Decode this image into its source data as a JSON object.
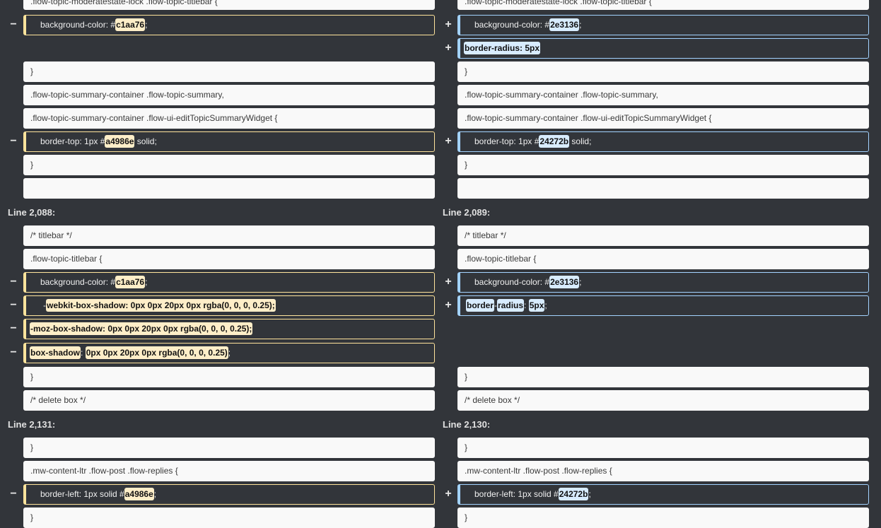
{
  "line_numbers": {
    "left_2": "Line 2,088:",
    "right_2": "Line 2,089:",
    "left_3": "Line 2,131:",
    "right_3": "Line 2,130:"
  },
  "markers": {
    "minus": "−",
    "plus": "+"
  },
  "block1": {
    "left_0": ".flow-topic-moderatestate-lock .flow-topic-titlebar {",
    "right_0": ".flow-topic-moderatestate-lock .flow-topic-titlebar {",
    "left_1": {
      "pre": "background-color: #",
      "hl": "c1aa76",
      "post": ";"
    },
    "right_1": {
      "pre": "background-color: #",
      "hl": "2e3136",
      "post": ";"
    },
    "right_2": {
      "hl": "border-radius: 5px"
    },
    "left_3": "}",
    "right_3": "}",
    "left_4": ".flow-topic-summary-container .flow-topic-summary,",
    "right_4": ".flow-topic-summary-container .flow-topic-summary,",
    "left_5": ".flow-topic-summary-container .flow-ui-editTopicSummaryWidget {",
    "right_5": ".flow-topic-summary-container .flow-ui-editTopicSummaryWidget {",
    "left_6": {
      "pre": "border-top: 1px #",
      "hl": "a4986e",
      "post": " solid;"
    },
    "right_6": {
      "pre": "border-top: 1px #",
      "hl": "24272b",
      "post": " solid;"
    },
    "left_7": "}",
    "right_7": "}",
    "left_8": "",
    "right_8": ""
  },
  "block2": {
    "left_0": "/* titlebar */",
    "right_0": "/* titlebar */",
    "left_1": ".flow-topic-titlebar {",
    "right_1": ".flow-topic-titlebar {",
    "left_2": {
      "pre": "background-color: #",
      "hl": "c1aa76",
      "post": ";"
    },
    "right_2": {
      "pre": "background-color: #",
      "hl": "2e3136",
      "post": ";"
    },
    "left_3": {
      "pre": "-",
      "hl": "webkit-box-shadow: 0px 0px 20px 0px rgba(0, 0, 0, 0.25);"
    },
    "right_3": {
      "hl1": "border",
      "sep1": "-",
      "hl2": "radius",
      "sep2": ": ",
      "hl3": "5px",
      "post": ";"
    },
    "left_4": {
      "hl": "-moz-box-shadow: 0px 0px 20px 0px rgba(0, 0, 0, 0.25);"
    },
    "left_5": {
      "hl1": "box-shadow",
      "sep": ": ",
      "hl2": "0px 0px 20px 0px rgba(0, 0, 0, 0.25)",
      "post": ";"
    },
    "left_6": "}",
    "right_6": "}",
    "left_7": "/* delete box */",
    "right_7": "/* delete box */"
  },
  "block3": {
    "left_0": "}",
    "right_0": "}",
    "left_1": ".mw-content-ltr .flow-post .flow-replies {",
    "right_1": ".mw-content-ltr .flow-post .flow-replies {",
    "left_2": {
      "pre": "border-left: 1px solid #",
      "hl": "a4986e",
      "post": ";"
    },
    "right_2": {
      "pre": "border-left: 1px solid #",
      "hl": "24272b",
      "post": ";"
    },
    "left_3": "}",
    "right_3": "}"
  }
}
